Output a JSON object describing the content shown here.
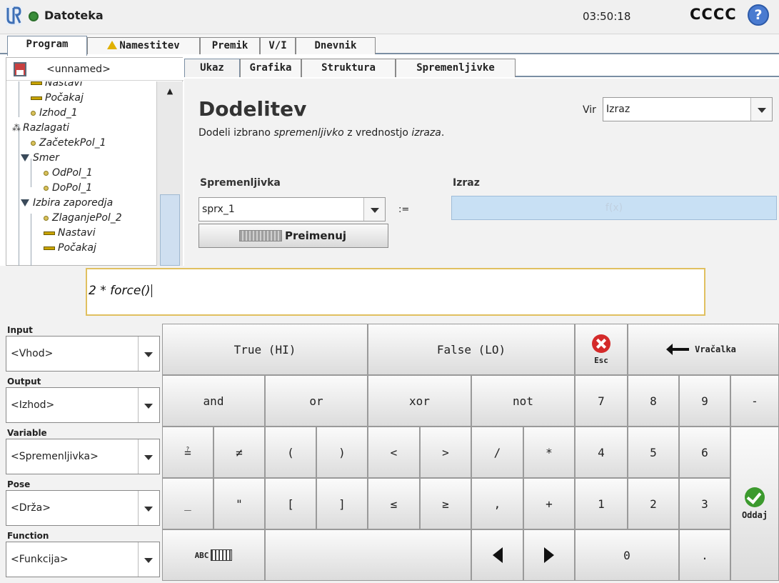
{
  "header": {
    "title": "Datoteka",
    "time": "03:50:18",
    "robot_name": "CCCC",
    "help": "?"
  },
  "main_tabs": [
    "Program",
    "Namestitev",
    "Premik",
    "V/I",
    "Dnevnik"
  ],
  "program_name": "<unnamed>",
  "tree": [
    {
      "label": "Nastavi"
    },
    {
      "label": "Počakaj"
    },
    {
      "label": "Izhod_1"
    },
    {
      "label": "Razlagati"
    },
    {
      "label": "ZačetekPol_1"
    },
    {
      "label": "Smer"
    },
    {
      "label": "OdPol_1"
    },
    {
      "label": "DoPol_1"
    },
    {
      "label": "Izbira zaporedja"
    },
    {
      "label": "ZlaganjePol_2"
    },
    {
      "label": "Nastavi"
    },
    {
      "label": "Počakaj"
    }
  ],
  "sub_tabs": [
    "Ukaz",
    "Grafika",
    "Struktura",
    "Spremenljivke"
  ],
  "content": {
    "heading": "Dodelitev",
    "description_parts": [
      "Dodeli izbrano ",
      "spremenljivko",
      " z vrednostjo ",
      "izraza",
      "."
    ],
    "vir_label": "Vir",
    "vir_value": "Izraz",
    "variable_label": "Spremenljivka",
    "variable_value": "sprx_1",
    "assign_op": ":=",
    "expression_label": "Izraz",
    "expression_placeholder": "f(x)",
    "rename_button": "Preimenuj"
  },
  "keyboard": {
    "input_value": "2 * force()",
    "side": [
      {
        "label": "Input",
        "value": "<Vhod>"
      },
      {
        "label": "Output",
        "value": "<Izhod>"
      },
      {
        "label": "Variable",
        "value": "<Spremenljivka>"
      },
      {
        "label": "Pose",
        "value": "<Drža>"
      },
      {
        "label": "Function",
        "value": "<Funkcija>"
      }
    ],
    "keys": {
      "true": "True (HI)",
      "false": "False (LO)",
      "esc": "Esc",
      "backspace": "Vračalka",
      "and": "and",
      "or": "or",
      "xor": "xor",
      "not": "not",
      "eq": "≟",
      "neq": "≠",
      "lparen": "(",
      "rparen": ")",
      "lt": "<",
      "gt": ">",
      "div": "/",
      "mul": "*",
      "underscore": "_",
      "quote": "\"",
      "lbracket": "[",
      "rbracket": "]",
      "le": "≤",
      "ge": "≥",
      "comma": ",",
      "plus": "+",
      "abc": "ABC",
      "n7": "7",
      "n8": "8",
      "n9": "9",
      "minus": "-",
      "n4": "4",
      "n5": "5",
      "n6": "6",
      "n1": "1",
      "n2": "2",
      "n3": "3",
      "n0": "0",
      "dot": ".",
      "submit": "Oddaj"
    }
  }
}
